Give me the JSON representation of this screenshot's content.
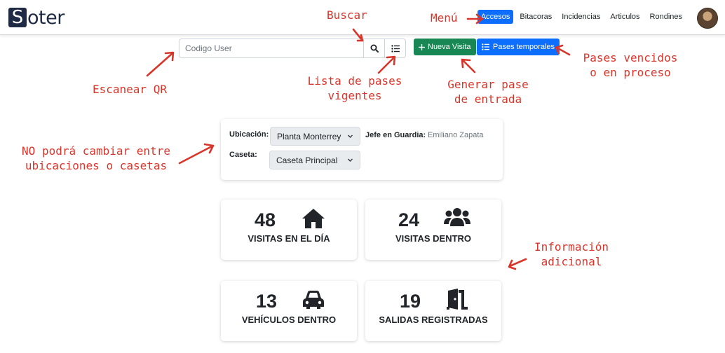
{
  "brand": {
    "initial": "S",
    "rest": "oter"
  },
  "nav": {
    "items": [
      {
        "label": "Accesos",
        "active": true
      },
      {
        "label": "Bitacoras",
        "active": false
      },
      {
        "label": "Incidencias",
        "active": false
      },
      {
        "label": "Articulos",
        "active": false
      },
      {
        "label": "Rondines",
        "active": false
      }
    ]
  },
  "toolbar": {
    "search_placeholder": "Codigo User",
    "new_visit_label": "Nueva Visita",
    "temp_passes_label": "Pases temporales"
  },
  "location": {
    "ubicacion_label": "Ubicación:",
    "ubicacion_value": "Planta Monterrey",
    "jefe_label": "Jefe en Guardia:",
    "jefe_value": "Emiliano Zapata",
    "caseta_label": "Caseta:",
    "caseta_value": "Caseta Principal"
  },
  "stats": [
    {
      "value": "48",
      "label": "VISITAS EN EL DÍA",
      "icon": "house-icon"
    },
    {
      "value": "24",
      "label": "VISITAS DENTRO",
      "icon": "users-icon"
    },
    {
      "value": "13",
      "label": "VEHÍCULOS DENTRO",
      "icon": "car-icon"
    },
    {
      "value": "19",
      "label": "SALIDAS REGISTRADAS",
      "icon": "door-exit-icon"
    }
  ],
  "annotations": {
    "buscar": "Buscar",
    "menu": "Menú",
    "escanear_qr": "Escanear QR",
    "lista_line1": "Lista de pases",
    "lista_line2": "vigentes",
    "generar_line1": "Generar pase",
    "generar_line2": "de entrada",
    "pases_line1": "Pases vencidos",
    "pases_line2": "o en proceso",
    "no_podra_line1": "NO podrá cambiar entre",
    "no_podra_line2": "ubicaciones o casetas",
    "info_line1": "Información",
    "info_line2": "adicional"
  },
  "colors": {
    "primary": "#0d6efd",
    "success": "#198754",
    "annotation": "#d9362b",
    "brand": "#1f2a44"
  }
}
